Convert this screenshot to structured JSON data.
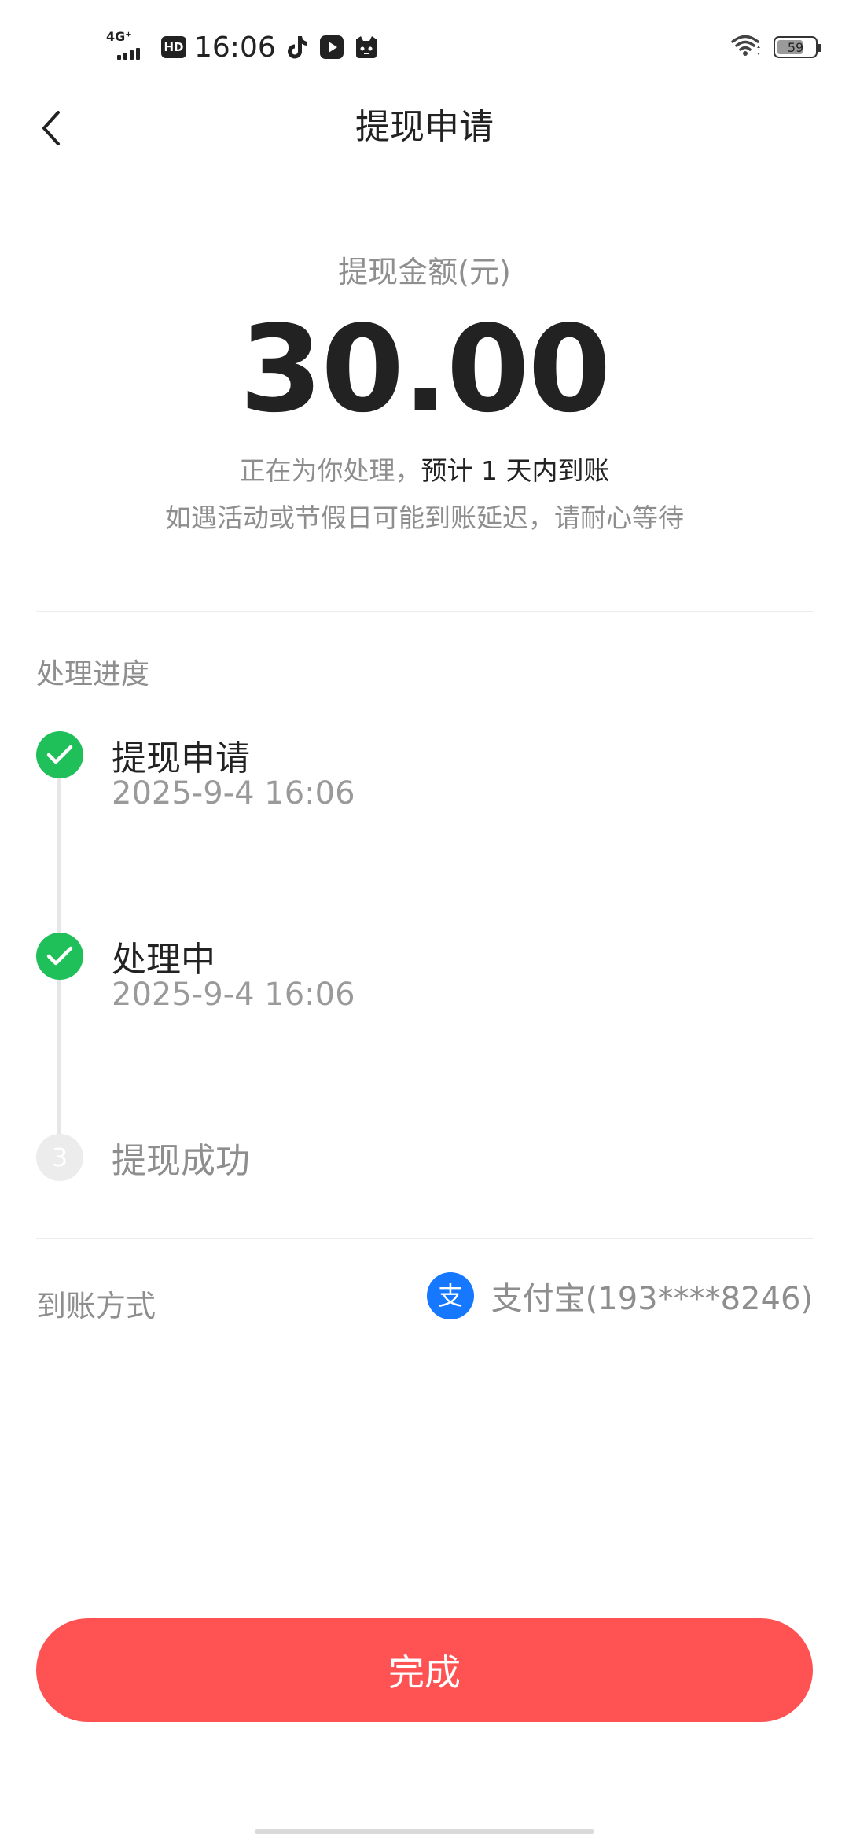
{
  "status_bar": {
    "network": "4G⁺",
    "hd": "HD",
    "time": "16:06",
    "battery": "59",
    "icons": [
      "tiktok-icon",
      "video-app-icon",
      "cat-app-icon",
      "wifi-icon"
    ]
  },
  "header": {
    "title": "提现申请",
    "back_icon": "chevron-left-icon"
  },
  "amount": {
    "label": "提现金额(元)",
    "value": "30.00",
    "note_prefix": "正在为你处理，",
    "note_highlight": "预计 1 天内到账",
    "note_line2": "如遇活动或节假日可能到账延迟，请耐心等待"
  },
  "progress": {
    "title": "处理进度",
    "steps": [
      {
        "label": "提现申请",
        "time": "2025-9-4 16:06",
        "status": "done"
      },
      {
        "label": "处理中",
        "time": "2025-9-4 16:06",
        "status": "done"
      },
      {
        "label": "提现成功",
        "number": "3",
        "status": "pending"
      }
    ]
  },
  "payment": {
    "label": "到账方式",
    "icon": "alipay-icon",
    "icon_char": "支",
    "value": "支付宝(193****8246)"
  },
  "done_button": {
    "label": "完成"
  },
  "colors": {
    "accent_red": "#ff5252",
    "success_green": "#1fc05a",
    "alipay_blue": "#1677ff",
    "muted_text": "#8e8e8e"
  }
}
